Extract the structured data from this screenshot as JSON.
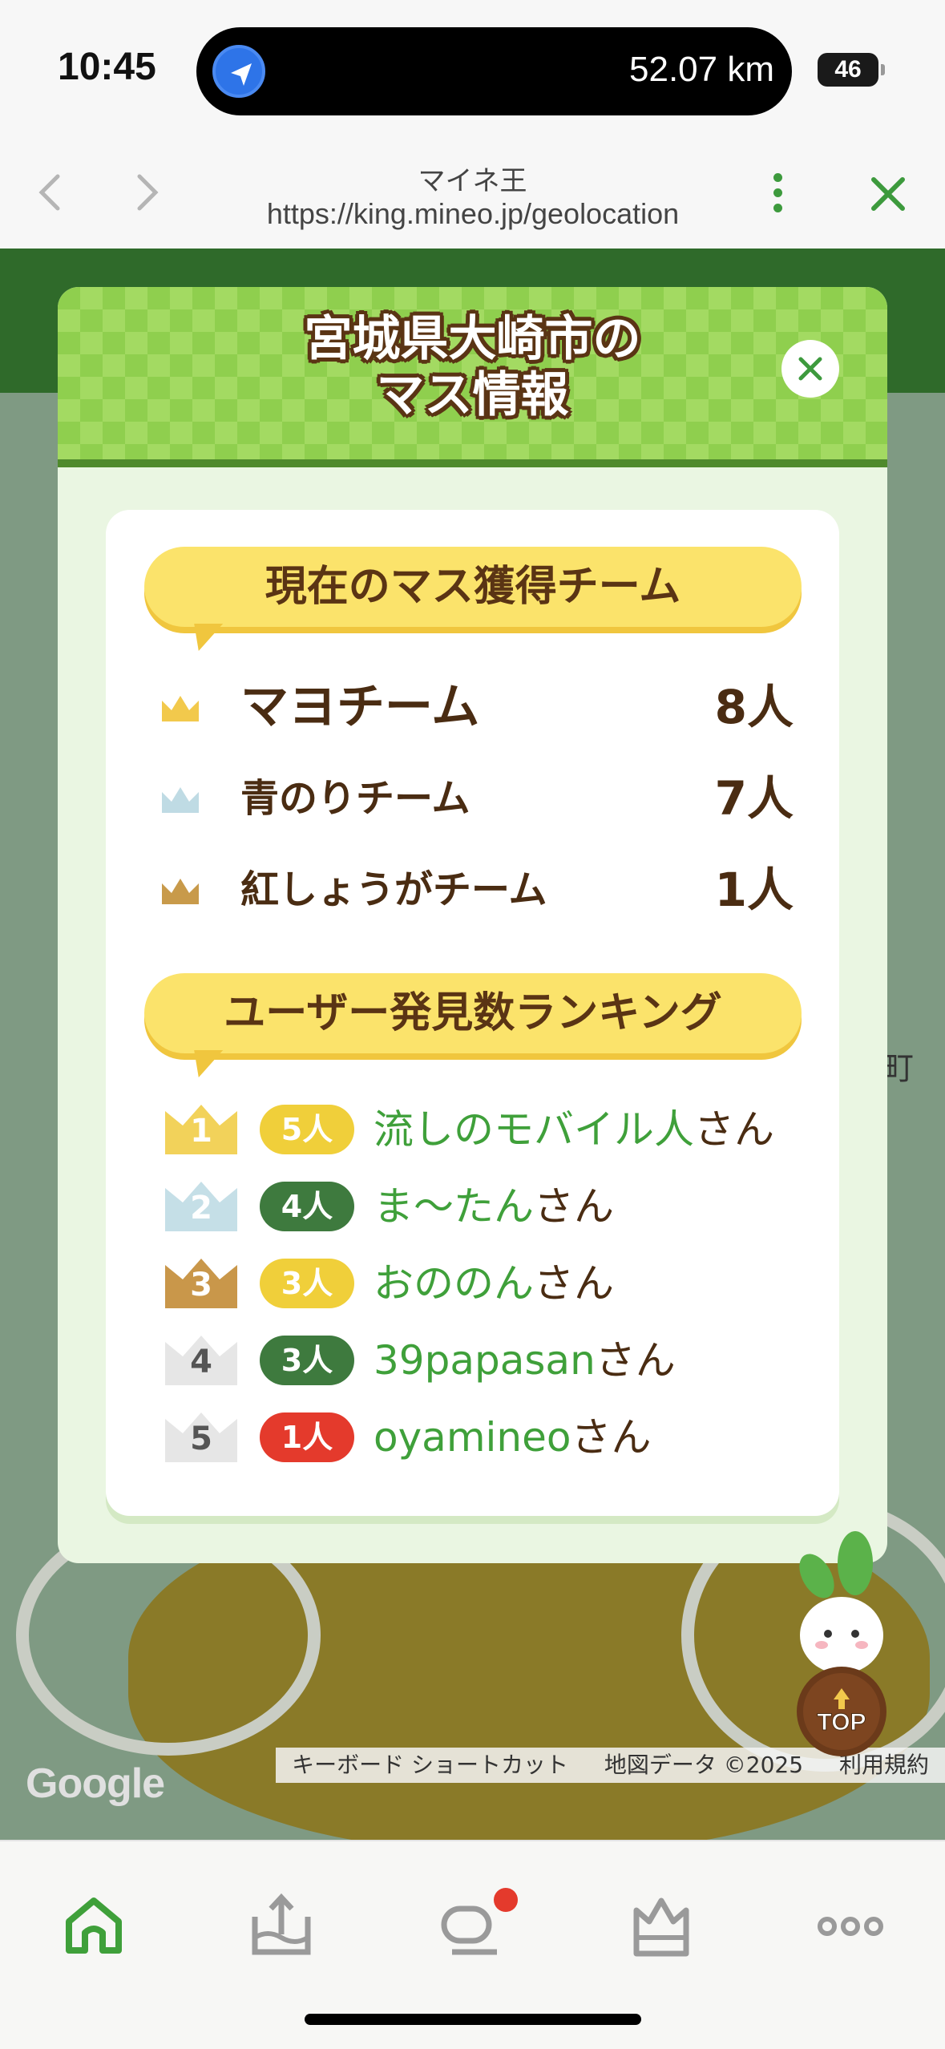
{
  "status_bar": {
    "time": "10:45",
    "distance": "52.07 km",
    "battery": "46"
  },
  "browser": {
    "title": "マイネ王",
    "url": "https://king.mineo.jp/geolocation"
  },
  "modal": {
    "title_line1": "宮城県大崎市の",
    "title_line2": "マス情報",
    "team_section_title": "現在のマス獲得チーム",
    "teams": [
      {
        "name": "マヨチーム",
        "count": "8人",
        "crown_color": "#f2c94c"
      },
      {
        "name": "青のりチーム",
        "count": "7人",
        "crown_color": "#bfdbe4"
      },
      {
        "name": "紅しょうがチーム",
        "count": "1人",
        "crown_color": "#c89a4a"
      }
    ],
    "ranking_section_title": "ユーザー発見数ランキング",
    "ranking": [
      {
        "rank": "1",
        "count": "5人",
        "name": "流しのモバイル人",
        "suffix": "さん",
        "crown_color": "#f2d25a",
        "pill_color": "#f0cf3a"
      },
      {
        "rank": "2",
        "count": "4人",
        "name": "ま〜たん",
        "suffix": "さん",
        "crown_color": "#c5dfe7",
        "pill_color": "#3e7a3e"
      },
      {
        "rank": "3",
        "count": "3人",
        "name": "おののん",
        "suffix": "さん",
        "crown_color": "#c9974a",
        "pill_color": "#f0cf3a"
      },
      {
        "rank": "4",
        "count": "3人",
        "name": "39papasan",
        "suffix": "さん",
        "crown_color": "#e6e6e6",
        "pill_color": "#3e7a3e"
      },
      {
        "rank": "5",
        "count": "1人",
        "name": "oyamineo",
        "suffix": "さん",
        "crown_color": "#e6e6e6",
        "pill_color": "#e43a2c"
      }
    ]
  },
  "map": {
    "google": "Google",
    "keyboard_shortcuts": "キーボード ショートカット",
    "map_data": "地図データ ©2025",
    "terms": "利用規約",
    "town_fragment": "町"
  },
  "mascot": {
    "top_label": "TOP"
  },
  "tabbar": {
    "items": [
      {
        "icon": "home-icon"
      },
      {
        "icon": "upload-tray-icon"
      },
      {
        "icon": "chat-icon"
      },
      {
        "icon": "crown-icon"
      },
      {
        "icon": "more-icon"
      }
    ]
  }
}
